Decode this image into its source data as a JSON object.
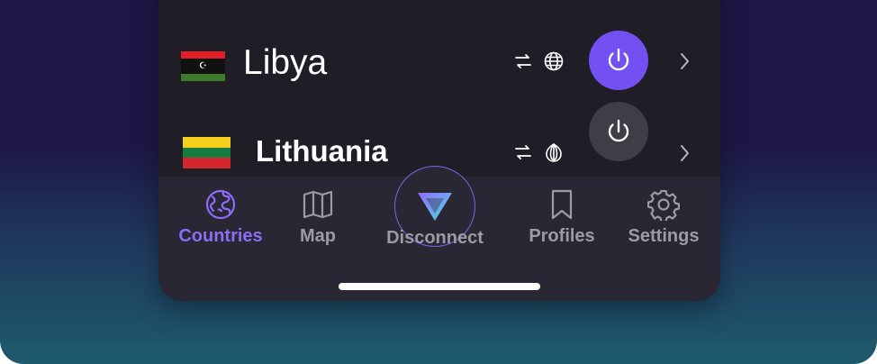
{
  "countries": [
    {
      "name": "Libya",
      "flag": "libya",
      "state": "connected",
      "features": [
        "p2p-icon",
        "globe-icon"
      ]
    },
    {
      "name": "Lithuania",
      "flag": "lithuania",
      "state": "disconnected",
      "features": [
        "p2p-icon",
        "tor-icon"
      ]
    }
  ],
  "tabbar": {
    "countries": "Countries",
    "map": "Map",
    "disconnect": "Disconnect",
    "profiles": "Profiles",
    "settings": "Settings",
    "active": "countries"
  },
  "colors": {
    "accent": "#7250f2",
    "active_tab": "#8b6cf6",
    "inactive_tab": "#9c9ba2",
    "panel": "#1f1d26",
    "tabbar": "#292733"
  }
}
